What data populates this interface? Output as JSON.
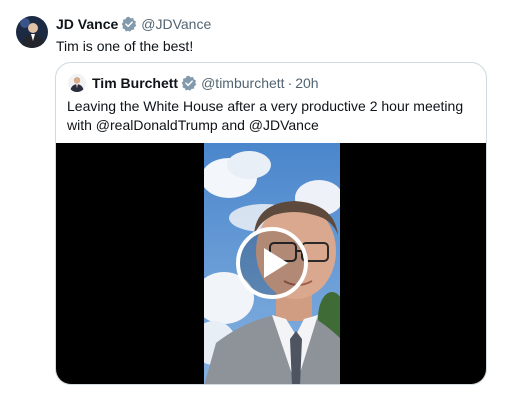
{
  "tweet": {
    "author_name": "JD Vance",
    "author_handle": "@JDVance",
    "text": "Tim is one of the best!",
    "avatar_icon": "user-avatar",
    "verified_icon": "verified-badge-icon"
  },
  "quoted_tweet": {
    "author_name": "Tim Burchett",
    "author_handle": "@timburchett",
    "separator": "·",
    "time": "20h",
    "text": "Leaving the White House after a very productive 2 hour meeting with @realDonaldTrump and @JDVance",
    "media": {
      "type": "video",
      "play_icon": "play-icon"
    }
  },
  "colors": {
    "text_primary": "#0f1419",
    "text_secondary": "#536471",
    "border": "#cfd9de",
    "verified": "#829aab"
  }
}
